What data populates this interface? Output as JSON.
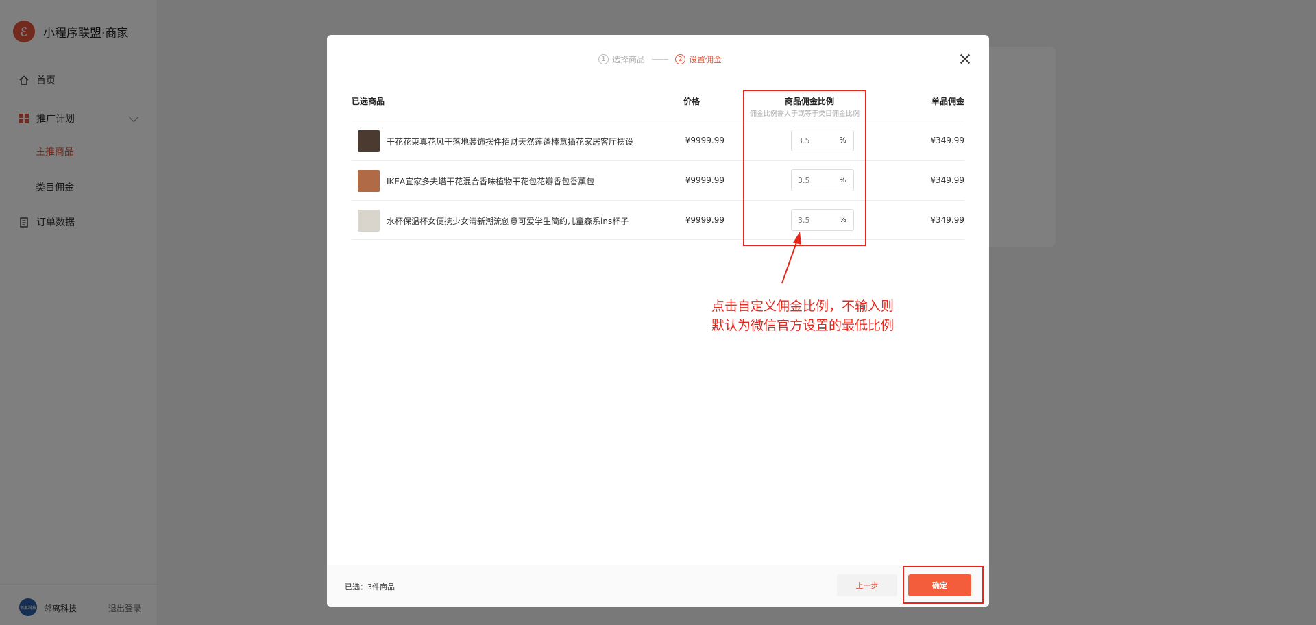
{
  "app": {
    "title": "小程序联盟·商家",
    "logo_glyph": "ℰ"
  },
  "sidebar": {
    "home": "首页",
    "promo_plan": "推广计划",
    "main_products": "主推商品",
    "category_commission": "类目佣金",
    "order_data": "订单数据",
    "org_name": "邻离科技",
    "avatar_text": "邻离科技",
    "logout": "退出登录"
  },
  "modal": {
    "step1_num": "1",
    "step1_label": "选择商品",
    "step2_num": "2",
    "step2_label": "设置佣金",
    "col_product": "已选商品",
    "col_price": "价格",
    "col_rate": "商品佣金比例",
    "col_rate_hint": "佣金比例需大于或等于类目佣金比例",
    "col_commission": "单品佣金",
    "products": [
      {
        "name": "干花花束真花风干落地装饰摆件招财天然莲蓬棒意插花家居客厅摆设",
        "price": "¥9999.99",
        "rate_placeholder": "3.5",
        "pct": "%",
        "commission": "¥349.99",
        "thumb_color": "#4a3a30"
      },
      {
        "name": "IKEA宜家多夫塔干花混合香味植物干花包花瓣香包香薰包",
        "price": "¥9999.99",
        "rate_placeholder": "3.5",
        "pct": "%",
        "commission": "¥349.99",
        "thumb_color": "#b06a45"
      },
      {
        "name": "水杯保温杯女便携少女清新潮流创意可爱学生简约儿童森系ins杯子",
        "price": "¥9999.99",
        "rate_placeholder": "3.5",
        "pct": "%",
        "commission": "¥349.99",
        "thumb_color": "#d9d4cc"
      }
    ],
    "annotation_line1": "点击自定义佣金比例，不输入则",
    "annotation_line2": "默认为微信官方设置的最低比例",
    "selected_count": "已选：3件商品",
    "prev_button": "上一步",
    "confirm_button": "确定"
  },
  "colors": {
    "accent": "#e5533d",
    "annotation_red": "#e8271c",
    "confirm": "#f45d3c"
  }
}
